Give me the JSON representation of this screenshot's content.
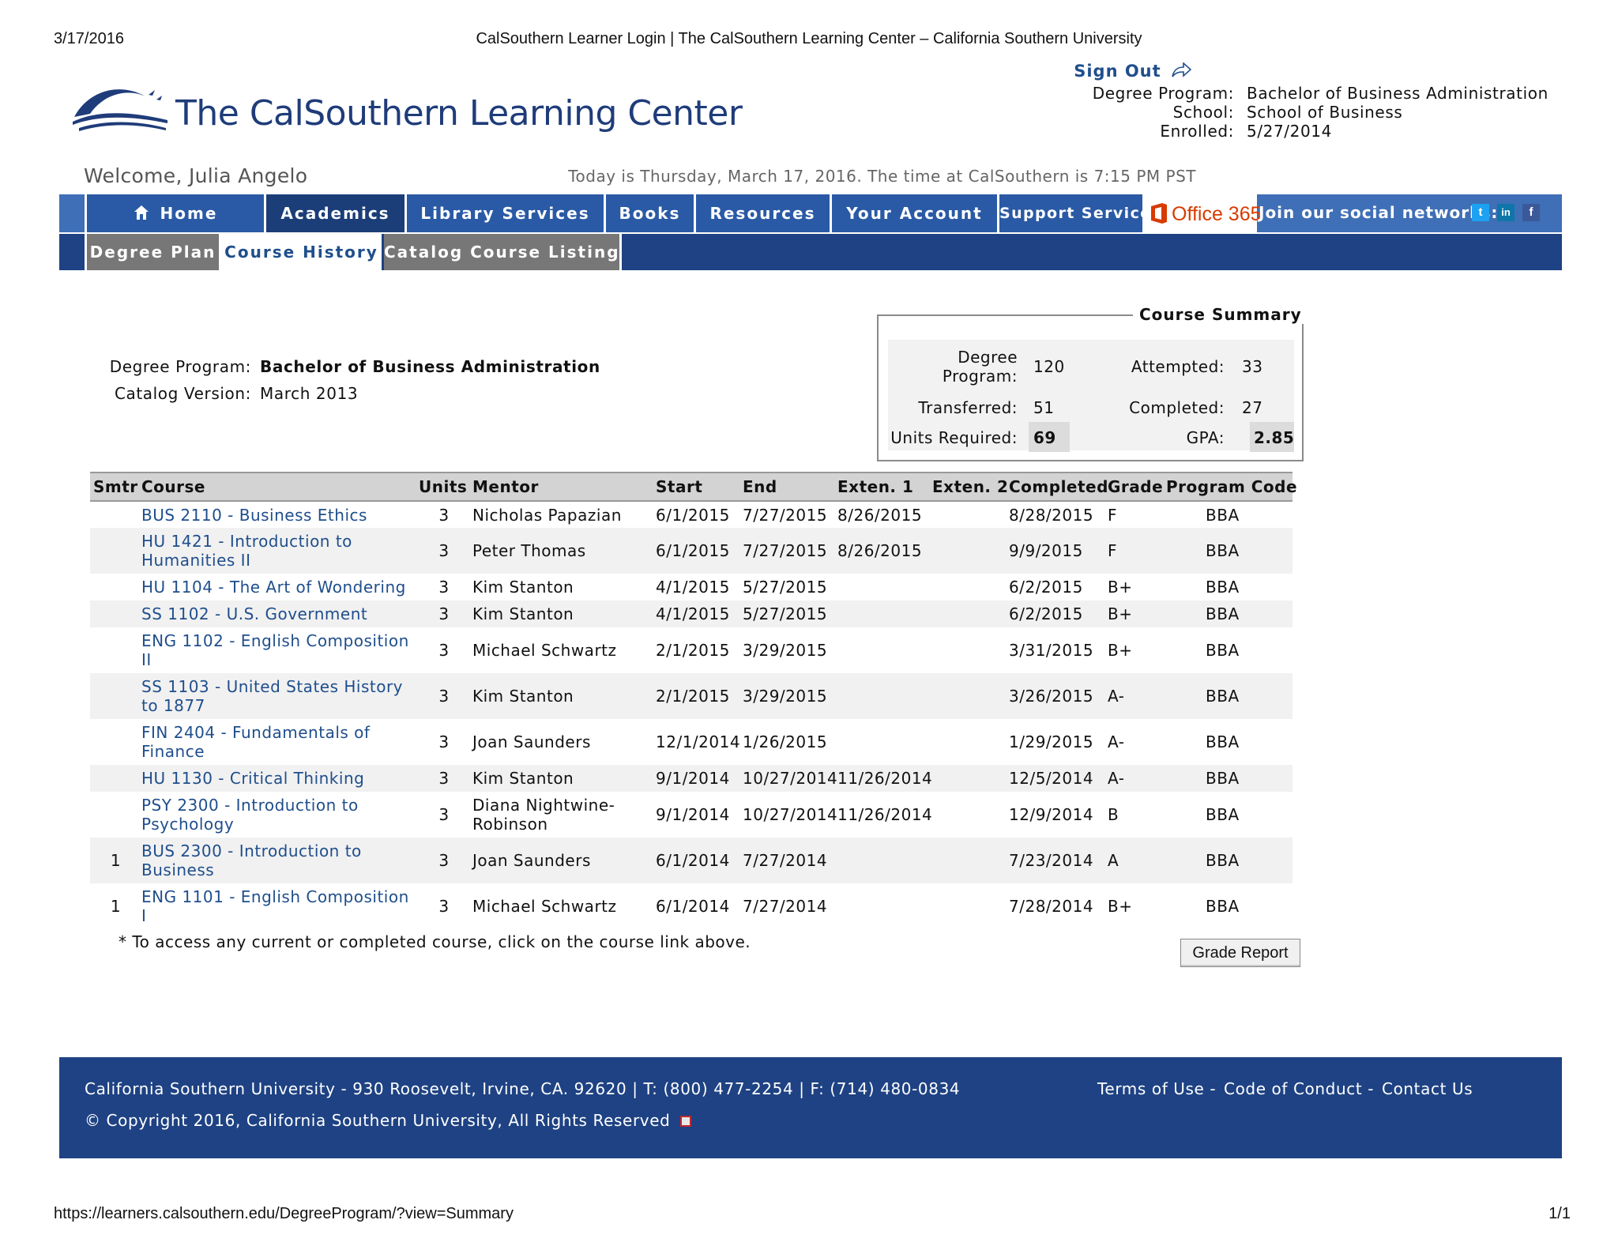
{
  "print_header": {
    "date": "3/17/2016",
    "title": "CalSouthern Learner Login | The CalSouthern Learning Center – California Southern University"
  },
  "print_footer": {
    "url": "https://learners.calsouthern.edu/DegreeProgram/?view=Summary",
    "page": "1/1"
  },
  "logo": {
    "text": "The CalSouthern Learning Center"
  },
  "header": {
    "sign_out": "Sign Out",
    "info": [
      {
        "label": "Degree Program:",
        "value": "Bachelor of Business Administration"
      },
      {
        "label": "School:",
        "value": "School of Business"
      },
      {
        "label": "Enrolled:",
        "value": "5/27/2014"
      }
    ],
    "welcome": "Welcome, Julia Angelo",
    "today": "Today is Thursday, March 17, 2016. The time at CalSouthern is 7:15 PM PST"
  },
  "nav": {
    "items": [
      "Home",
      "Academics",
      "Library Services",
      "Books",
      "Resources",
      "Your Account",
      "Support Services"
    ],
    "active": "Academics",
    "office_label": "Office 365",
    "social_label": "Join our social networks:",
    "social_icons": [
      "twitter-icon",
      "linkedin-icon",
      "facebook-icon"
    ],
    "social_glyphs": [
      "t",
      "in",
      "f"
    ]
  },
  "subnav": {
    "items": [
      "Degree Plan",
      "Course History",
      "Catalog Course Listing"
    ],
    "current": "Course History"
  },
  "degree": {
    "program_label": "Degree Program:",
    "program_value": "Bachelor of Business Administration",
    "catalog_label": "Catalog Version:",
    "catalog_value": "March 2013"
  },
  "summary": {
    "title": "Course Summary",
    "degree_program_label_1": "Degree",
    "degree_program_label_2": "Program:",
    "degree_program_value": "120",
    "attempted_label": "Attempted:",
    "attempted_value": "33",
    "transferred_label": "Transferred:",
    "transferred_value": "51",
    "completed_label": "Completed:",
    "completed_value": "27",
    "units_required_label": "Units Required:",
    "units_required_value": "69",
    "gpa_label": "GPA:",
    "gpa_value": "2.85"
  },
  "courses": {
    "columns": [
      "Smtr",
      "Course",
      "Units",
      "Mentor",
      "Start",
      "End",
      "Exten. 1",
      "Exten. 2",
      "Completed",
      "Grade",
      "Program Code"
    ],
    "rows": [
      {
        "smtr": "",
        "course": "BUS 2110 - Business Ethics",
        "units": "3",
        "mentor": "Nicholas Papazian",
        "start": "6/1/2015",
        "end": "7/27/2015",
        "ext1": "8/26/2015",
        "ext2": "",
        "completed": "8/28/2015",
        "grade": "F",
        "program": "BBA"
      },
      {
        "smtr": "",
        "course": "HU 1421 - Introduction to Humanities II",
        "units": "3",
        "mentor": "Peter Thomas",
        "start": "6/1/2015",
        "end": "7/27/2015",
        "ext1": "8/26/2015",
        "ext2": "",
        "completed": "9/9/2015",
        "grade": "F",
        "program": "BBA"
      },
      {
        "smtr": "",
        "course": "HU 1104 - The Art of Wondering",
        "units": "3",
        "mentor": "Kim Stanton",
        "start": "4/1/2015",
        "end": "5/27/2015",
        "ext1": "",
        "ext2": "",
        "completed": "6/2/2015",
        "grade": "B+",
        "program": "BBA"
      },
      {
        "smtr": "",
        "course": "SS 1102 - U.S. Government",
        "units": "3",
        "mentor": "Kim Stanton",
        "start": "4/1/2015",
        "end": "5/27/2015",
        "ext1": "",
        "ext2": "",
        "completed": "6/2/2015",
        "grade": "B+",
        "program": "BBA"
      },
      {
        "smtr": "",
        "course": "ENG 1102 - English Composition II",
        "units": "3",
        "mentor": "Michael Schwartz",
        "start": "2/1/2015",
        "end": "3/29/2015",
        "ext1": "",
        "ext2": "",
        "completed": "3/31/2015",
        "grade": "B+",
        "program": "BBA"
      },
      {
        "smtr": "",
        "course": "SS 1103 - United States History to 1877",
        "units": "3",
        "mentor": "Kim Stanton",
        "start": "2/1/2015",
        "end": "3/29/2015",
        "ext1": "",
        "ext2": "",
        "completed": "3/26/2015",
        "grade": "A-",
        "program": "BBA"
      },
      {
        "smtr": "",
        "course": "FIN 2404 - Fundamentals of Finance",
        "units": "3",
        "mentor": "Joan Saunders",
        "start": "12/1/2014",
        "end": "1/26/2015",
        "ext1": "",
        "ext2": "",
        "completed": "1/29/2015",
        "grade": "A-",
        "program": "BBA"
      },
      {
        "smtr": "",
        "course": "HU 1130 - Critical Thinking",
        "units": "3",
        "mentor": "Kim Stanton",
        "start": "9/1/2014",
        "end": "10/27/2014",
        "ext1": "11/26/2014",
        "ext2": "",
        "completed": "12/5/2014",
        "grade": "A-",
        "program": "BBA"
      },
      {
        "smtr": "",
        "course": "PSY 2300 - Introduction to Psychology",
        "units": "3",
        "mentor": "Diana Nightwine-Robinson",
        "start": "9/1/2014",
        "end": "10/27/2014",
        "ext1": "11/26/2014",
        "ext2": "",
        "completed": "12/9/2014",
        "grade": "B",
        "program": "BBA"
      },
      {
        "smtr": "1",
        "course": "BUS 2300 - Introduction to Business",
        "units": "3",
        "mentor": "Joan Saunders",
        "start": "6/1/2014",
        "end": "7/27/2014",
        "ext1": "",
        "ext2": "",
        "completed": "7/23/2014",
        "grade": "A",
        "program": "BBA"
      },
      {
        "smtr": "1",
        "course": "ENG 1101 - English Composition I",
        "units": "3",
        "mentor": "Michael Schwartz",
        "start": "6/1/2014",
        "end": "7/27/2014",
        "ext1": "",
        "ext2": "",
        "completed": "7/28/2014",
        "grade": "B+",
        "program": "BBA"
      }
    ]
  },
  "note": "* To access any current or completed course, click on the course link above.",
  "grade_report_label": "Grade Report",
  "footer": {
    "address": "California Southern University - 930 Roosevelt, Irvine, CA. 92620 | T: (800) 477-2254 | F: (714) 480-0834",
    "copyright": "© Copyright 2016, California Southern University, All Rights Reserved",
    "links": [
      "Terms of Use -",
      "Code of Conduct -",
      "Contact Us"
    ]
  },
  "colors": {
    "nav_blue": "#2a5aa5",
    "nav_active": "#1b3d78",
    "footer_blue": "#1e4283",
    "link_blue": "#1f4e8c",
    "office_orange": "#d83b01"
  }
}
